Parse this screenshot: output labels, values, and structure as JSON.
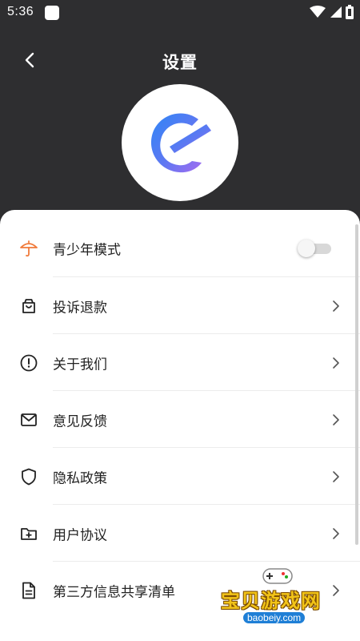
{
  "status_bar": {
    "time": "5:36",
    "icons": [
      "app-notification-icon",
      "wifi-icon",
      "signal-icon",
      "battery-icon"
    ]
  },
  "header": {
    "title": "设置",
    "back_icon": "chevron-left-icon"
  },
  "logo": {
    "icon": "app-logo-e-icon"
  },
  "settings": {
    "items": [
      {
        "label": "青少年模式",
        "icon": "umbrella-icon",
        "icon_color": "#f07a3a",
        "type": "toggle",
        "toggle_on": false
      },
      {
        "label": "投诉退款",
        "icon": "shopping-bag-icon",
        "type": "link"
      },
      {
        "label": "关于我们",
        "icon": "info-circle-icon",
        "type": "link"
      },
      {
        "label": "意见反馈",
        "icon": "mail-icon",
        "type": "link"
      },
      {
        "label": "隐私政策",
        "icon": "shield-icon",
        "type": "link"
      },
      {
        "label": "用户协议",
        "icon": "folder-plus-icon",
        "type": "link"
      },
      {
        "label": "第三方信息共享清单",
        "icon": "document-icon",
        "type": "link"
      }
    ]
  },
  "watermark": {
    "text": "宝贝游戏网",
    "url": "baobeiy.com"
  },
  "colors": {
    "header_bg": "#2e2e30",
    "card_bg": "#ffffff",
    "accent_orange": "#f07a3a",
    "logo_gradient_start": "#3f7cf2",
    "logo_gradient_end": "#8a6cf0"
  }
}
